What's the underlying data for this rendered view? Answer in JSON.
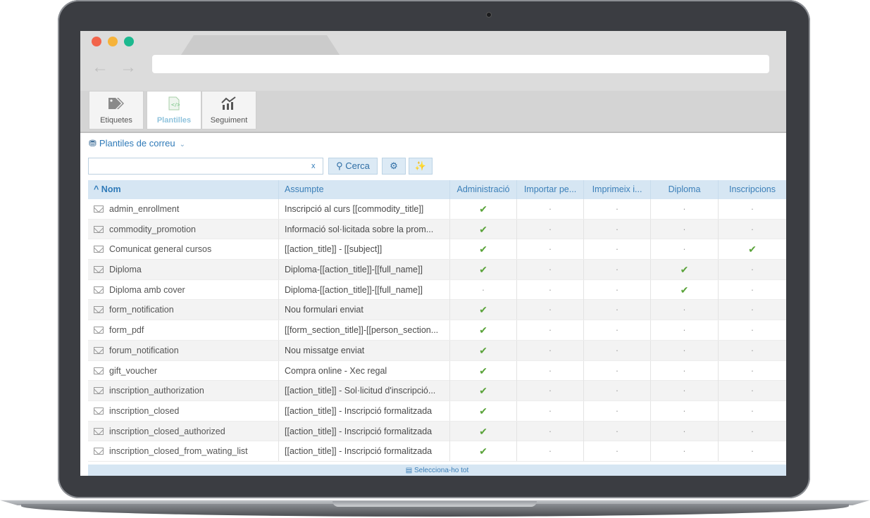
{
  "toolbar": {
    "items": [
      {
        "label": "Etiquetes",
        "icon": "tags-icon"
      },
      {
        "label": "Plantilles",
        "icon": "document-icon",
        "active": true
      },
      {
        "label": "Seguiment",
        "icon": "chart-icon"
      }
    ]
  },
  "section": {
    "title": "Plantiles de correu"
  },
  "search": {
    "value": "",
    "clear": "x",
    "button": "Cerca"
  },
  "table": {
    "columns": [
      "Nom",
      "Assumpte",
      "Administració",
      "Importar pe...",
      "Imprimeix i...",
      "Diploma",
      "Inscripcions"
    ],
    "check_mark": "✔",
    "dot_mark": "·",
    "rows": [
      {
        "name": "admin_enrollment",
        "subject": "Inscripció al curs [[commodity_title]]",
        "flags": [
          true,
          false,
          false,
          false,
          false
        ]
      },
      {
        "name": "commodity_promotion",
        "subject": "Informació sol·licitada sobre la prom...",
        "flags": [
          true,
          false,
          false,
          false,
          false
        ]
      },
      {
        "name": "Comunicat general cursos",
        "subject": "[[action_title]] - [[subject]]",
        "flags": [
          true,
          false,
          false,
          false,
          true
        ]
      },
      {
        "name": "Diploma",
        "subject": "Diploma-[[action_title]]-[[full_name]]",
        "flags": [
          true,
          false,
          false,
          true,
          false
        ]
      },
      {
        "name": "Diploma amb cover",
        "subject": "Diploma-[[action_title]]-[[full_name]]",
        "flags": [
          false,
          false,
          false,
          true,
          false
        ]
      },
      {
        "name": "form_notification",
        "subject": "Nou formulari enviat",
        "flags": [
          true,
          false,
          false,
          false,
          false
        ]
      },
      {
        "name": "form_pdf",
        "subject": "[[form_section_title]]-[[person_section...",
        "flags": [
          true,
          false,
          false,
          false,
          false
        ]
      },
      {
        "name": "forum_notification",
        "subject": "Nou missatge enviat",
        "flags": [
          true,
          false,
          false,
          false,
          false
        ]
      },
      {
        "name": "gift_voucher",
        "subject": "Compra online - Xec regal",
        "flags": [
          true,
          false,
          false,
          false,
          false
        ]
      },
      {
        "name": "inscription_authorization",
        "subject": "[[action_title]] - Sol·licitud d'inscripció...",
        "flags": [
          true,
          false,
          false,
          false,
          false
        ]
      },
      {
        "name": "inscription_closed",
        "subject": "[[action_title]] - Inscripció formalitzada",
        "flags": [
          true,
          false,
          false,
          false,
          false
        ]
      },
      {
        "name": "inscription_closed_authorized",
        "subject": "[[action_title]] - Inscripció formalitzada",
        "flags": [
          true,
          false,
          false,
          false,
          false
        ]
      },
      {
        "name": "inscription_closed_from_wating_list",
        "subject": "[[action_title]] - Inscripció formalitzada",
        "flags": [
          true,
          false,
          false,
          false,
          false
        ]
      }
    ]
  },
  "footer": {
    "label": "Selecciona-ho tot"
  }
}
